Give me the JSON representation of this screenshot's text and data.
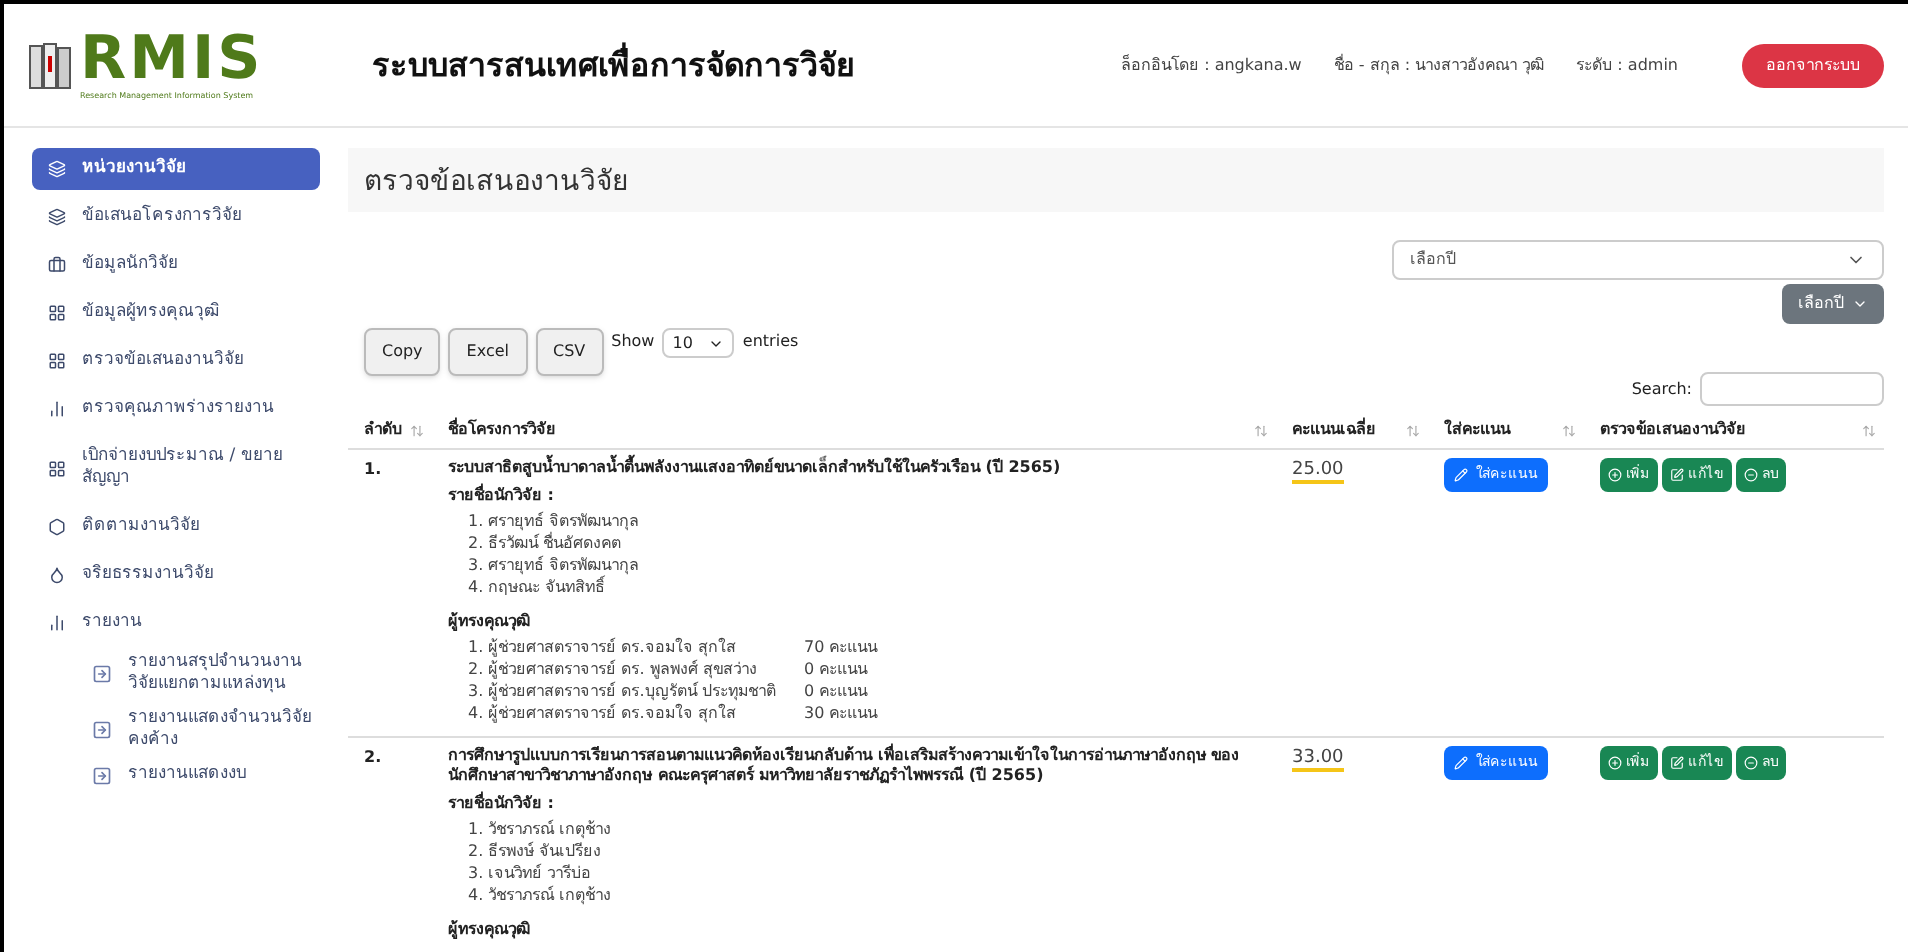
{
  "header": {
    "logo": {
      "text": "RMIS",
      "subtitle": "Research Management Information System"
    },
    "title": "ระบบสารสนเทศเพื่อการจัดการวิจัย",
    "login": "ล็อกอินโดย : angkana.w",
    "fullname": "ชื่อ - สกุล : นางสาวอังคณา วุฒิ",
    "level": "ระดับ : admin",
    "logout": "ออกจากระบบ"
  },
  "sidebar": {
    "items": [
      {
        "label": "หน่วยงานวิจัย",
        "selected": true
      },
      {
        "label": "ข้อเสนอโครงการวิจัย",
        "selected": false
      },
      {
        "label": "ข้อมูลนักวิจัย",
        "selected": false
      },
      {
        "label": "ข้อมูลผู้ทรงคุณวุฒิ",
        "selected": false
      },
      {
        "label": "ตรวจข้อเสนองานวิจัย",
        "selected": false
      },
      {
        "label": "ตรวจคุณภาพร่างรายงาน",
        "selected": false
      },
      {
        "label": "เบิกจ่ายงบประมาณ / ขยายสัญญา",
        "selected": false
      },
      {
        "label": "ติดตามงานวิจัย",
        "selected": false
      },
      {
        "label": "จริยธรรมงานวิจัย",
        "selected": false
      },
      {
        "label": "รายงาน",
        "selected": false,
        "expanded": true,
        "children": [
          {
            "label": "รายงานสรุปจำนวนงานวิจัยแยกตามแหล่งทุน",
            "selected": false
          },
          {
            "label": "รายงานแสดงจำนวนวิจัยคงค้าง",
            "selected": false
          },
          {
            "label": "รายงานแสดงงบ",
            "selected": false
          }
        ]
      }
    ]
  },
  "page_title": "ตรวจข้อเสนองานวิจัย",
  "year_select": {
    "value": "เลือกปี"
  },
  "year_button": "เลือกปี",
  "export_buttons": [
    "Copy",
    "Excel",
    "CSV"
  ],
  "length": {
    "prefix": "Show",
    "value": "10",
    "suffix": "entries"
  },
  "search": {
    "label": "Search:"
  },
  "table": {
    "columns": [
      "ลำดับ",
      "ชื่อโครงการวิจัย",
      "คะแนนเฉลี่ย",
      "ใส่คะแนน",
      "ตรวจข้อเสนองานวิจัย"
    ],
    "rows": [
      {
        "no": "1.",
        "title": "ระบบสาธิตสูบน้ำบาดาลน้ำตื้นพลังงานแสงอาทิตย์ขนาดเล็กสำหรับใช้ในครัวเรือน (ปี 2565)",
        "researchers_label": "รายชื่อนักวิจัย :",
        "researchers": [
          "1. ศรายุทธ์ จิตรพัฒนากุล",
          "2. ธีรวัฒน์ ชื่นอัศดงคต",
          "3. ศรายุทธ์ จิตรพัฒนากุล",
          "4. กฤษณะ จันทสิทธิ์"
        ],
        "reviewers_label": "ผู้ทรงคุณวุฒิ",
        "reviewers": [
          {
            "name": "1. ผู้ช่วยศาสตราจารย์ ดร.จอมใจ สุกใส",
            "score": "70 คะแนน"
          },
          {
            "name": "2. ผู้ช่วยศาสตราจารย์ ดร. พูลพงศ์ สุขสว่าง",
            "score": "0 คะแนน"
          },
          {
            "name": "3. ผู้ช่วยศาสตราจารย์ ดร.บุญรัตน์ ประทุมชาติ",
            "score": "0 คะแนน"
          },
          {
            "name": "4. ผู้ช่วยศาสตราจารย์ ดร.จอมใจ สุกใส",
            "score": "30 คะแนน"
          }
        ],
        "average": "25.00",
        "score_button": "ใส่คะแนน",
        "action_buttons": [
          "เพิ่ม",
          "แก้ไข",
          "ลบ"
        ]
      },
      {
        "no": "2.",
        "title": "การศึกษารูปแบบการเรียนการสอนตามแนวคิดห้องเรียนกลับด้าน เพื่อเสริมสร้างความเข้าใจในการอ่านภาษาอังกฤษ ของนักศึกษาสาขาวิชาภาษาอังกฤษ คณะครุศาสตร์ มหาวิทยาลัยราชภัฏรำไพพรรณี (ปี 2565)",
        "researchers_label": "รายชื่อนักวิจัย :",
        "researchers": [
          "1. วัชราภรณ์ เกตุช้าง",
          "2. ธีรพงษ์ จันเปรียง",
          "3. เจนวิทย์ วารีบ่อ",
          "4. วัชราภรณ์ เกตุช้าง"
        ],
        "reviewers_label": "ผู้ทรงคุณวุฒิ",
        "reviewers": [],
        "average": "33.00",
        "score_button": "ใส่คะแนน",
        "action_buttons": [
          "เพิ่ม",
          "แก้ไข",
          "ลบ"
        ]
      }
    ]
  }
}
